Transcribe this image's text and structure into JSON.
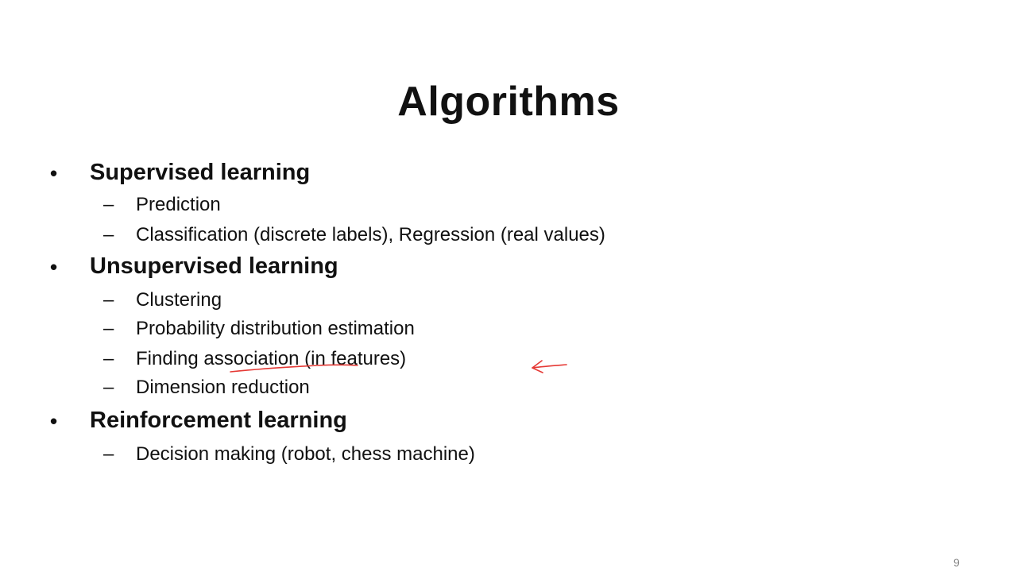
{
  "slide": {
    "title": "Algorithms",
    "page_number": "9",
    "bullets": [
      {
        "label": "Supervised learning",
        "items": [
          "Prediction",
          "Classification (discrete labels), Regression (real values)"
        ]
      },
      {
        "label": "Unsupervised learning",
        "items": [
          "Clustering",
          "Probability distribution estimation",
          "Finding association (in features)",
          "Dimension reduction"
        ]
      },
      {
        "label": "Reinforcement learning",
        "items": [
          "Decision making (robot, chess machine)"
        ]
      }
    ],
    "bullet_glyph": "•",
    "dash_glyph": "–",
    "annotation_color": "#e53935"
  }
}
